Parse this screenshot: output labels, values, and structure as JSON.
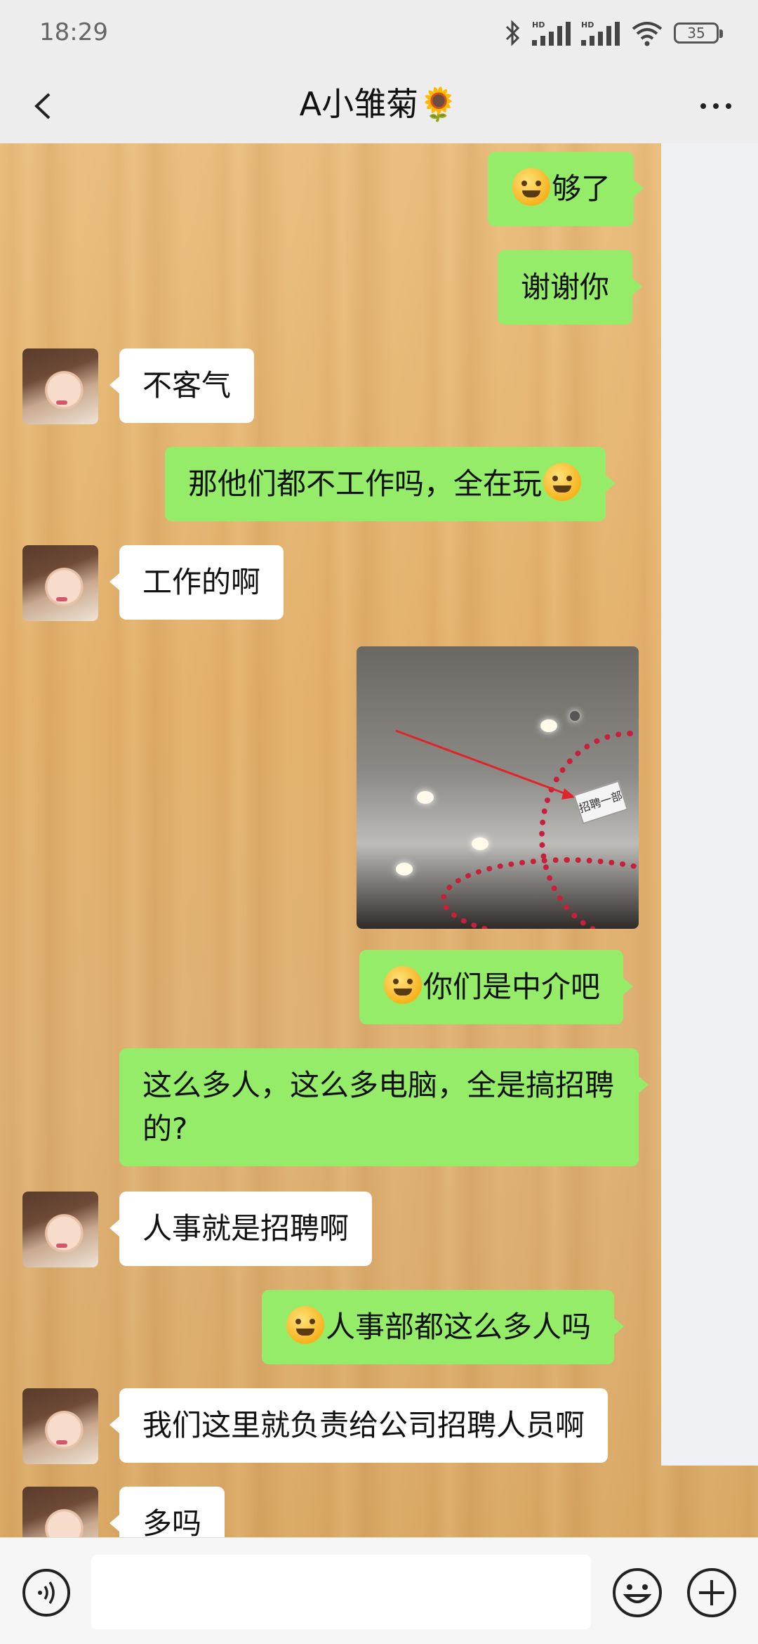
{
  "status_bar": {
    "time": "18:29",
    "battery": "35"
  },
  "header": {
    "title": "A小雏菊🌻"
  },
  "messages": [
    {
      "side": "right",
      "emoji_before": true,
      "text": "够了"
    },
    {
      "side": "right",
      "text": "谢谢你"
    },
    {
      "side": "left",
      "text": "不客气"
    },
    {
      "side": "right",
      "text": "那他们都不工作吗，全在玩",
      "emoji_after": true
    },
    {
      "side": "left",
      "text": "工作的啊"
    },
    {
      "side": "right",
      "type": "image",
      "sign_text": "招聘一部"
    },
    {
      "side": "right",
      "emoji_before": true,
      "text": "你们是中介吧"
    },
    {
      "side": "right",
      "text": "这么多人，这么多电脑，全是搞招聘的?"
    },
    {
      "side": "left",
      "text": "人事就是招聘啊"
    },
    {
      "side": "right",
      "emoji_before": true,
      "text": "人事部都这么多人吗"
    },
    {
      "side": "left",
      "text": "我们这里就负责给公司招聘人员啊"
    },
    {
      "side": "left",
      "text": "多吗"
    }
  ],
  "input": {
    "placeholder": ""
  },
  "colors": {
    "sent_bubble": "#95ec69",
    "received_bubble": "#ffffff",
    "header_bg": "#ededed"
  }
}
